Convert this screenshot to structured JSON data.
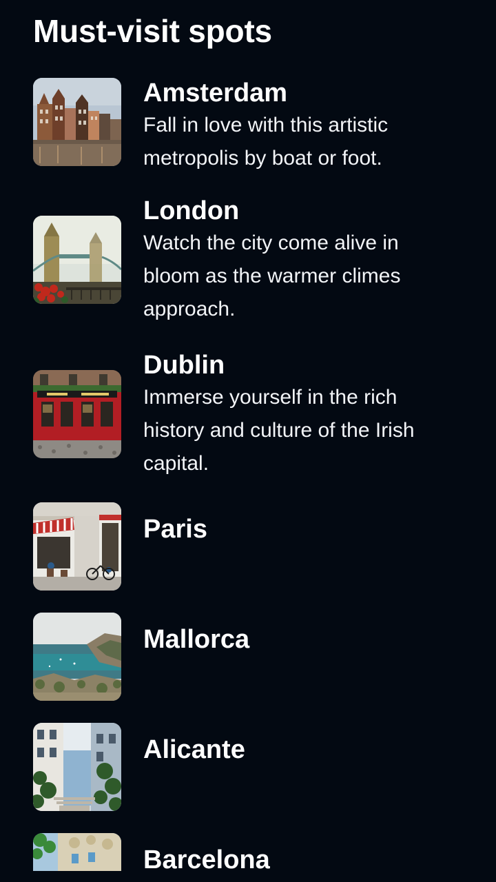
{
  "header": {
    "title": "Must-visit spots"
  },
  "spots": [
    {
      "name": "Amsterdam",
      "description": "Fall in love with this artistic metropolis by boat or foot.",
      "image": "amsterdam-canal-houses-photo"
    },
    {
      "name": "London",
      "description": "Watch the city come alive in bloom as the warmer climes approach.",
      "image": "tower-bridge-photo"
    },
    {
      "name": "Dublin",
      "description": "Immerse yourself in the rich history and culture of the Irish capital.",
      "image": "red-irish-pub-photo"
    },
    {
      "name": "Paris",
      "description": "",
      "image": "paris-cafe-photo"
    },
    {
      "name": "Mallorca",
      "description": "",
      "image": "mallorca-coast-photo"
    },
    {
      "name": "Alicante",
      "description": "",
      "image": "alicante-street-photo"
    },
    {
      "name": "Barcelona",
      "description": "",
      "image": "barcelona-building-photo"
    }
  ],
  "colors": {
    "background": "#030912",
    "text": "#ffffff"
  }
}
